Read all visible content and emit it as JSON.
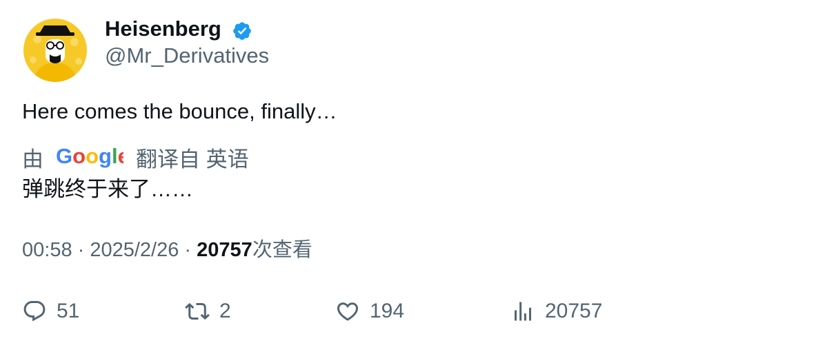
{
  "author": {
    "display_name": "Heisenberg",
    "handle": "@Mr_Derivatives",
    "verified": true,
    "avatar_icon": "heisenberg-avatar"
  },
  "tweet": {
    "text": "Here comes the bounce, finally…"
  },
  "translation": {
    "prefix": "由",
    "provider": "Google",
    "suffix": "翻译自 英语",
    "text": "弹跳终于来了……"
  },
  "meta": {
    "time": "00:58",
    "sep1": " · ",
    "date": "2025/2/26",
    "sep2": " · ",
    "views_count": "20757",
    "views_label": "次查看"
  },
  "actions": {
    "replies": "51",
    "retweets": "2",
    "likes": "194",
    "views": "20757"
  },
  "colors": {
    "text": "#0f1419",
    "secondary": "#536471",
    "verified": "#1d9bf0",
    "avatar_bg": "#f5c518"
  }
}
